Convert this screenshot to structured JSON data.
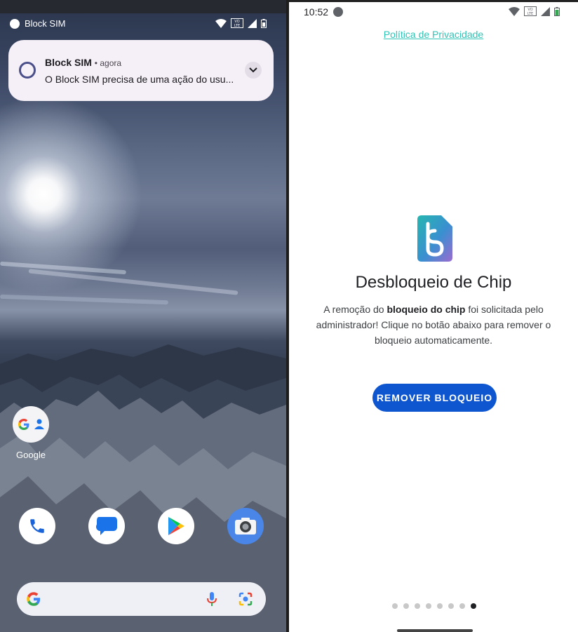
{
  "left": {
    "status": {
      "app_name": "Block SIM"
    },
    "notification": {
      "app": "Block SIM",
      "time": "agora",
      "body": "O Block SIM precisa de uma ação do usu..."
    },
    "folder_label": "Google",
    "dock_icons": [
      "phone-icon",
      "messages-icon",
      "play-store-icon",
      "camera-icon"
    ],
    "search_icons": [
      "google-g-icon",
      "microphone-icon",
      "lens-icon"
    ]
  },
  "right": {
    "status": {
      "time": "10:52"
    },
    "privacy_link": "Política de Privacidade",
    "headline": "Desbloqueio de Chip",
    "desc_prefix": "A remoção do ",
    "desc_bold": "bloqueio do chip",
    "desc_suffix": " foi solicitada pelo administrador! Clique no botão abaixo para remover o bloqueio automaticamente.",
    "button_label": "REMOVER BLOQUEIO",
    "pager": {
      "total": 8,
      "current": 8
    },
    "colors": {
      "accent": "#0d56d0",
      "link": "#2ec4b6"
    }
  }
}
